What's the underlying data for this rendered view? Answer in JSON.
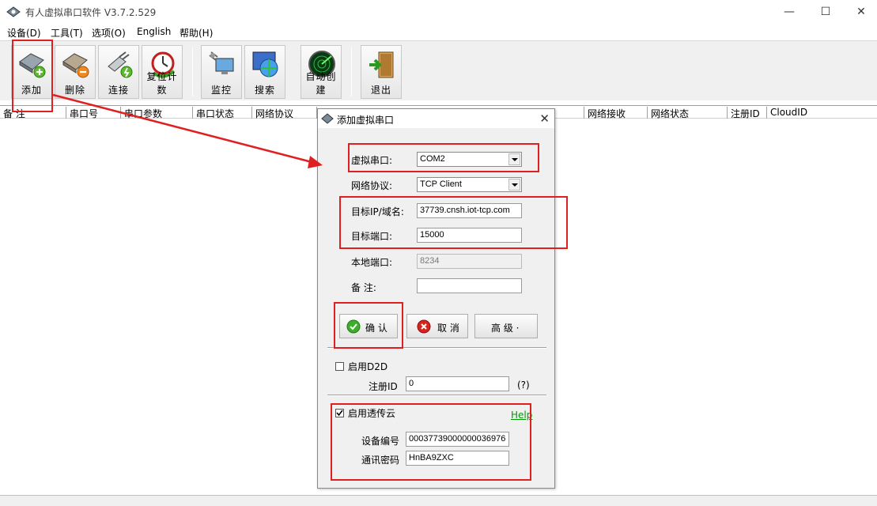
{
  "window": {
    "title": "有人虚拟串口软件 V3.7.2.529",
    "controls": {
      "minimize": "—",
      "maximize": "☐",
      "close": "✕"
    }
  },
  "menu": [
    "设备(D)",
    "工具(T)",
    "选项(O)",
    "English",
    "帮助(H)"
  ],
  "toolbar": {
    "add": "添加",
    "delete": "删除",
    "connect": "连接",
    "reset_count": "复位计数",
    "monitor": "监控",
    "search": "搜索",
    "auto_create": "自动创建",
    "exit": "退出"
  },
  "grid": {
    "columns": [
      "备 注",
      "串口号",
      "串口参数",
      "串口状态",
      "网络协议",
      "",
      "",
      "",
      "",
      "网络接收",
      "网络状态",
      "注册ID",
      "CloudID"
    ]
  },
  "dialog": {
    "title": "添加虚拟串口",
    "virtual_port": {
      "label": "虚拟串口:",
      "value": "COM2"
    },
    "protocol": {
      "label": "网络协议:",
      "value": "TCP Client"
    },
    "target_ip": {
      "label": "目标IP/域名:",
      "value": "37739.cnsh.iot-tcp.com"
    },
    "target_port": {
      "label": "目标端口:",
      "value": "15000"
    },
    "local_port": {
      "label": "本地端口:",
      "value": "8234"
    },
    "remark": {
      "label": "备 注:",
      "value": ""
    },
    "buttons": {
      "confirm": "确 认",
      "cancel": "取 消",
      "advanced": "高 级 ·"
    },
    "d2d": {
      "label": "启用D2D",
      "checked": false
    },
    "register_id": {
      "label": "注册ID",
      "value": "0",
      "hint": "(?)"
    },
    "cloud": {
      "label": "启用透传云",
      "checked": true,
      "help": "Help",
      "device_id": {
        "label": "设备编号",
        "value": "00037739000000036976"
      },
      "password": {
        "label": "通讯密码",
        "value": "HnBA9ZXC"
      }
    }
  },
  "colors": {
    "annotation_red": "#e02020",
    "help_green": "#009900",
    "dialog_border": "#6c8fc0"
  }
}
